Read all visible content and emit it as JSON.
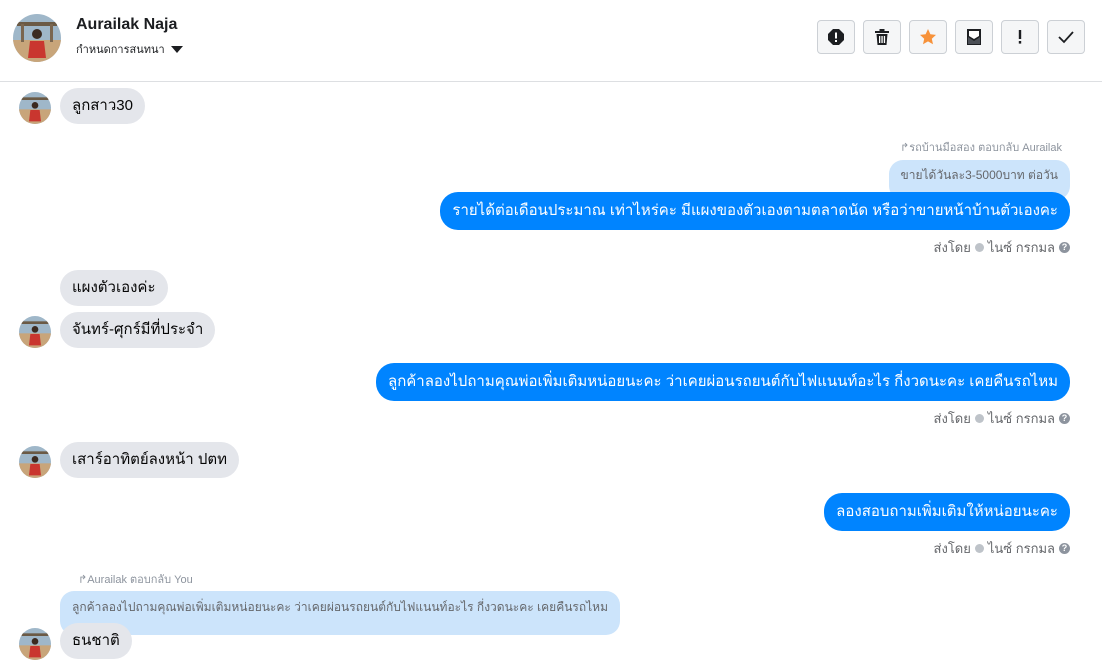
{
  "header": {
    "name": "Aurailak Naja",
    "subtitle": "กำหนดการสนทนา",
    "toolbar": [
      {
        "name": "report-icon"
      },
      {
        "name": "trash-icon"
      },
      {
        "name": "star-icon",
        "color": "#f7923a"
      },
      {
        "name": "mail-archive-icon"
      },
      {
        "name": "exclamation-icon"
      },
      {
        "name": "check-icon"
      }
    ]
  },
  "messages": [
    {
      "text": "ลูกสาว30"
    },
    {
      "reply_label": "↱รถบ้านมือสอง ตอบกลับ Aurailak",
      "quote": "ขายได้วันละ3-5000บาท ต่อวัน",
      "text": "รายได้ต่อเดือนประมาณ เท่าไหร่คะ มีแผงของตัวเองตามตลาดนัด หรือว่าขายหน้าบ้านตัวเองคะ",
      "sent_prefix": "ส่งโดย",
      "sender": "ไนซ์ กรกมล"
    },
    {
      "text": "แผงตัวเองค่ะ"
    },
    {
      "text": "จันทร์-ศุกร์มีที่ประจำ"
    },
    {
      "text": "ลูกค้าลองไปถามคุณพ่อเพิ่มเติมหน่อยนะคะ ว่าเคยผ่อนรถยนต์กับไฟแนนท์อะไร กี่งวดนะคะ เคยคืนรถไหม",
      "sent_prefix": "ส่งโดย",
      "sender": "ไนซ์ กรกมล"
    },
    {
      "text": "เสาร์อาทิตย์ลงหน้า ปตท"
    },
    {
      "text": "ลองสอบถามเพิ่มเติมให้หน่อยนะคะ",
      "sent_prefix": "ส่งโดย",
      "sender": "ไนซ์ กรกมล"
    },
    {
      "reply_label": "↱Aurailak ตอบกลับ You",
      "quote": "ลูกค้าลองไปถามคุณพ่อเพิ่มเติมหน่อยนะคะ ว่าเคยผ่อนรถยนต์กับไฟแนนท์อะไร กี่งวดนะคะ เคยคืนรถไหม",
      "text": "ธนชาติ"
    }
  ],
  "colors": {
    "outgoing": "#0084ff",
    "incoming": "#e4e6eb",
    "quote": "#cce4fb"
  }
}
